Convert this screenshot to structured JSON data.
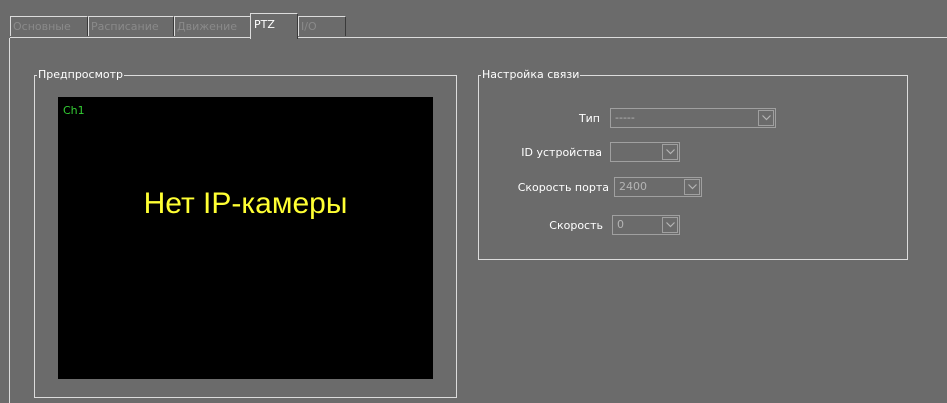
{
  "tabs": [
    {
      "label": "Основные",
      "active": false
    },
    {
      "label": "Расписание",
      "active": false
    },
    {
      "label": "Движение",
      "active": false
    },
    {
      "label": "PTZ",
      "active": true
    },
    {
      "label": "I/O",
      "active": false
    }
  ],
  "preview": {
    "title": "Предпросмотр",
    "channel": "Ch1",
    "message": "Нет IP-камеры"
  },
  "connection": {
    "title": "Настройка связи",
    "type_label": "Тип",
    "type_value": "-----",
    "device_id_label": "ID устройства",
    "device_id_value": "",
    "port_speed_label": "Скорость порта",
    "port_speed_value": "2400",
    "speed_label": "Скорость",
    "speed_value": "0"
  },
  "colors": {
    "background": "#6b6b6b",
    "preview_bg": "#000000",
    "channel_text": "#33cc33",
    "message_text": "#ffff33"
  },
  "icons": {
    "dropdown": "chevron-down-icon"
  }
}
